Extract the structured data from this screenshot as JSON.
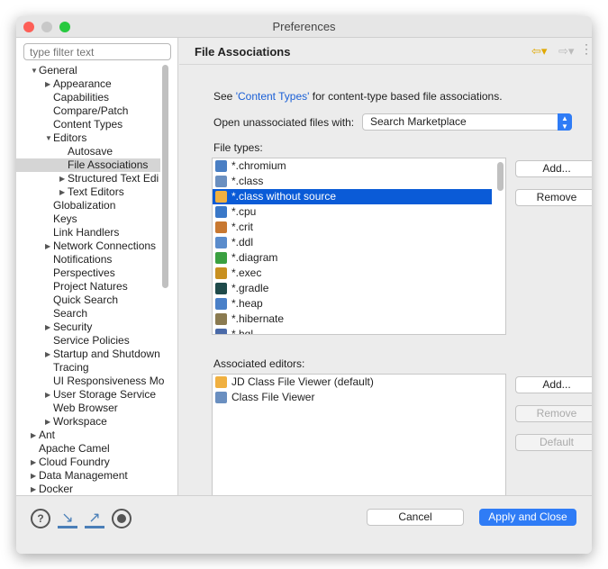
{
  "window": {
    "title": "Preferences"
  },
  "sidebar": {
    "filter_placeholder": "type filter text",
    "items": [
      {
        "label": "General",
        "level": 0,
        "arrow": "down"
      },
      {
        "label": "Appearance",
        "level": 1,
        "arrow": "right"
      },
      {
        "label": "Capabilities",
        "level": 1
      },
      {
        "label": "Compare/Patch",
        "level": 1
      },
      {
        "label": "Content Types",
        "level": 1
      },
      {
        "label": "Editors",
        "level": 1,
        "arrow": "down"
      },
      {
        "label": "Autosave",
        "level": 2
      },
      {
        "label": "File Associations",
        "level": 2,
        "selected": true
      },
      {
        "label": "Structured Text Edi",
        "level": 2,
        "arrow": "right"
      },
      {
        "label": "Text Editors",
        "level": 2,
        "arrow": "right"
      },
      {
        "label": "Globalization",
        "level": 1
      },
      {
        "label": "Keys",
        "level": 1
      },
      {
        "label": "Link Handlers",
        "level": 1
      },
      {
        "label": "Network Connections",
        "level": 1,
        "arrow": "right"
      },
      {
        "label": "Notifications",
        "level": 1
      },
      {
        "label": "Perspectives",
        "level": 1
      },
      {
        "label": "Project Natures",
        "level": 1
      },
      {
        "label": "Quick Search",
        "level": 1
      },
      {
        "label": "Search",
        "level": 1
      },
      {
        "label": "Security",
        "level": 1,
        "arrow": "right"
      },
      {
        "label": "Service Policies",
        "level": 1
      },
      {
        "label": "Startup and Shutdown",
        "level": 1,
        "arrow": "right"
      },
      {
        "label": "Tracing",
        "level": 1
      },
      {
        "label": "UI Responsiveness Mo",
        "level": 1
      },
      {
        "label": "User Storage Service",
        "level": 1,
        "arrow": "right"
      },
      {
        "label": "Web Browser",
        "level": 1
      },
      {
        "label": "Workspace",
        "level": 1,
        "arrow": "right"
      },
      {
        "label": "Ant",
        "level": 0,
        "arrow": "right"
      },
      {
        "label": "Apache Camel",
        "level": 0
      },
      {
        "label": "Cloud Foundry",
        "level": 0,
        "arrow": "right"
      },
      {
        "label": "Data Management",
        "level": 0,
        "arrow": "right"
      },
      {
        "label": "Docker",
        "level": 0,
        "arrow": "right"
      }
    ]
  },
  "page": {
    "title": "File Associations",
    "see_prefix": "See ",
    "see_link": "'Content Types'",
    "see_suffix": " for content-type based file associations.",
    "open_label": "Open unassociated files with:",
    "open_value": "Search Marketplace",
    "file_types_label": "File types:",
    "file_types": [
      {
        "label": "*.chromium",
        "icon": "chromium-icon",
        "color": "#4a7fc4"
      },
      {
        "label": "*.class",
        "icon": "class-file-icon",
        "color": "#6a8fc0"
      },
      {
        "label": "*.class without source",
        "icon": "coffee-cup-icon",
        "color": "#f0b040",
        "selected": true
      },
      {
        "label": "*.cpu",
        "icon": "cpu-clock-icon",
        "color": "#3a78c8"
      },
      {
        "label": "*.crit",
        "icon": "crit-icon",
        "color": "#c87830"
      },
      {
        "label": "*.ddl",
        "icon": "ddl-icon",
        "color": "#5a8ccc"
      },
      {
        "label": "*.diagram",
        "icon": "diagram-icon",
        "color": "#3aa040"
      },
      {
        "label": "*.exec",
        "icon": "gears-icon",
        "color": "#c89020"
      },
      {
        "label": "*.gradle",
        "icon": "elephant-icon",
        "color": "#1e4a4a"
      },
      {
        "label": "*.heap",
        "icon": "heap-icon",
        "color": "#4a80c8"
      },
      {
        "label": "*.hibernate",
        "icon": "hibernate-icon",
        "color": "#8a7a50"
      },
      {
        "label": "*.hql",
        "icon": "hql-icon",
        "color": "#4a6aa8"
      }
    ],
    "add_label": "Add...",
    "remove_label": "Remove",
    "editors_label": "Associated editors:",
    "editors": [
      {
        "label": "JD Class File Viewer (default)",
        "icon": "coffee-cup-icon",
        "color": "#f0b040"
      },
      {
        "label": "Class File Viewer",
        "icon": "class-file-icon",
        "color": "#6a8fc0"
      }
    ],
    "editor_add_label": "Add...",
    "editor_remove_label": "Remove",
    "default_label": "Default"
  },
  "footer": {
    "cancel_label": "Cancel",
    "apply_label": "Apply and Close"
  },
  "colors": {
    "accent": "#0a5bd7",
    "apply_button": "#2f7cf6"
  }
}
